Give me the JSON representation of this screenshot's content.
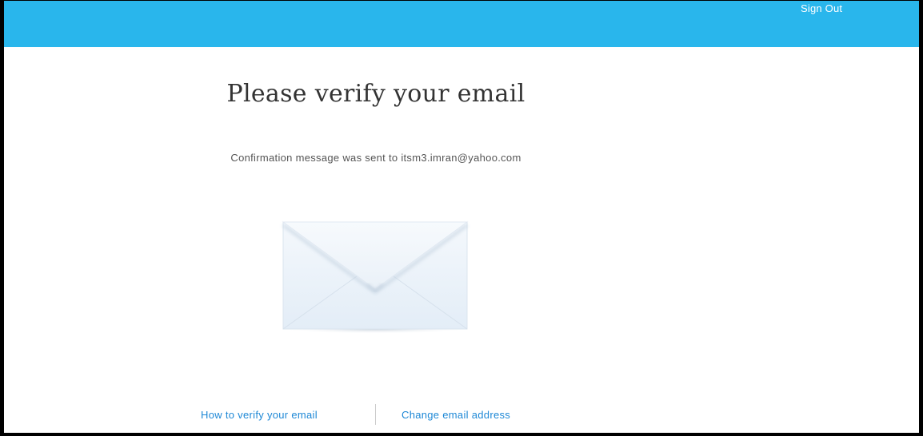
{
  "header": {
    "sign_out_label": "Sign Out",
    "color": "#29b6ec"
  },
  "main": {
    "title": "Please verify your email",
    "message": "Confirmation message was sent to itsm3.imran@yahoo.com",
    "illustration_icon": "envelope-icon"
  },
  "footer": {
    "how_to_verify_label": "How to verify your email",
    "change_email_label": "Change email address",
    "link_color": "#1e88d6"
  }
}
